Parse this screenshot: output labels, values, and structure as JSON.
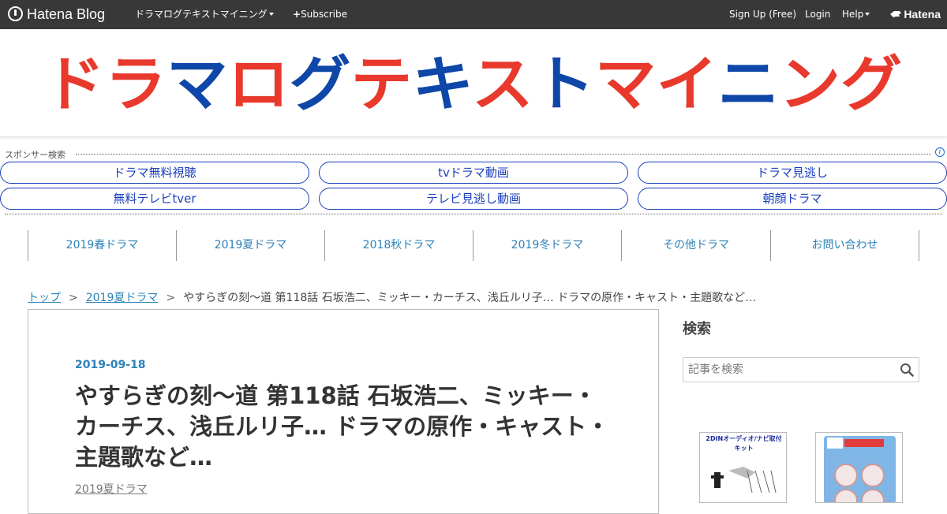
{
  "topbar": {
    "brand": "Hatena Blog",
    "blog_menu": "ドラマログテキストマイニング",
    "subscribe": "Subscribe",
    "signup": "Sign Up (Free)",
    "login": "Login",
    "help": "Help",
    "hatena": "Hatena"
  },
  "header": {
    "blog_title": "ドラマログテキストマイニング"
  },
  "sponsor": {
    "label": "スポンサー検索",
    "links": [
      "ドラマ無料視聴",
      "tvドラマ動画",
      "ドラマ見逃し",
      "無料テレビtver",
      "テレビ見逃し動画",
      "朝顔ドラマ"
    ]
  },
  "nav": {
    "items": [
      "2019春ドラマ",
      "2019夏ドラマ",
      "2018秋ドラマ",
      "2019冬ドラマ",
      "その他ドラマ",
      "お問い合わせ"
    ]
  },
  "breadcrumb": {
    "top": "トップ",
    "sep": ">",
    "category": "2019夏ドラマ",
    "current": "やすらぎの刻～道 第118話 石坂浩二、ミッキー・カーチス、浅丘ルリ子… ドラマの原作・キャスト・主題歌など…"
  },
  "article": {
    "date": "2019-09-18",
    "title": "やすらぎの刻～道 第118話 石坂浩二、ミッキー・カーチス、浅丘ルリ子… ドラマの原作・キャスト・主題歌など…",
    "category": "2019夏ドラマ"
  },
  "sidebar": {
    "search_title": "検索",
    "search_placeholder": "記事を検索",
    "ad1_text": "2DINオーディオ/ナビ取付キット"
  },
  "colors": {
    "topbar_bg": "#383838",
    "title_red": "#e8392c",
    "title_blue": "#0f47a8",
    "link_blue": "#2c82b8",
    "pill_blue": "#1a3fbd"
  }
}
